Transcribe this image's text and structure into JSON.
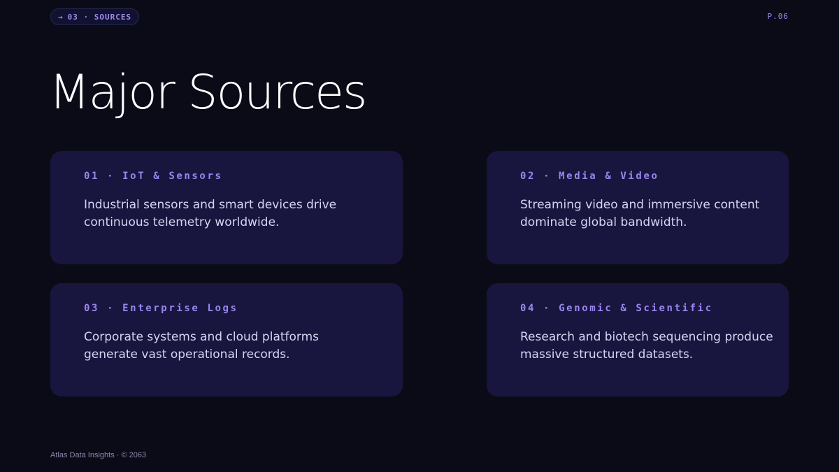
{
  "header": {
    "section_arrow": "→",
    "section_label": "03 · SOURCES",
    "page_number": "P.06"
  },
  "title": "Major Sources",
  "cards": [
    {
      "label": "01 · IoT & Sensors",
      "text": "Industrial sensors and smart devices drive continuous telemetry worldwide."
    },
    {
      "label": "02 · Media & Video",
      "text": "Streaming video and immersive content dominate global bandwidth."
    },
    {
      "label": "03 · Enterprise Logs",
      "text": "Corporate systems and cloud platforms generate vast operational records."
    },
    {
      "label": "04 · Genomic & Scientific",
      "text": "Research and biotech sequencing produce massive structured datasets."
    }
  ],
  "footer": "Atlas Data Insights · © 2063",
  "colors": {
    "background": "#0b0b17",
    "card": "#18163f",
    "accent": "#9a86ee",
    "body_text": "#d7d4f0"
  }
}
